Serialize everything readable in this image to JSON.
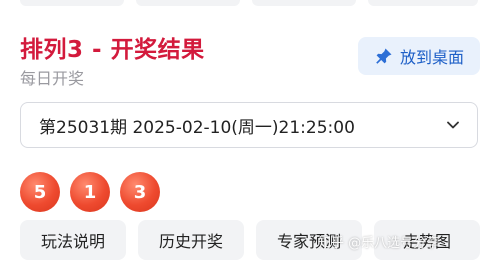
{
  "header": {
    "title": "排列3 - 开奖结果",
    "subtitle": "每日开奖"
  },
  "desktop_button": {
    "label": "放到桌面",
    "icon": "pin-icon"
  },
  "issue_selector": {
    "value": "第25031期 2025-02-10(周一)21:25:00",
    "icon": "chevron-down-icon"
  },
  "result": {
    "balls": [
      "5",
      "1",
      "3"
    ],
    "ball_color": "#ee4a2f"
  },
  "tabs": [
    {
      "label": "玩法说明"
    },
    {
      "label": "历史开奖"
    },
    {
      "label": "专家预测"
    },
    {
      "label": "走势图"
    }
  ],
  "watermark": "知乎 @乐八选号分享",
  "colors": {
    "title": "#d31a3c",
    "accent": "#1d5fc7",
    "button_bg": "#e9f1fc"
  }
}
